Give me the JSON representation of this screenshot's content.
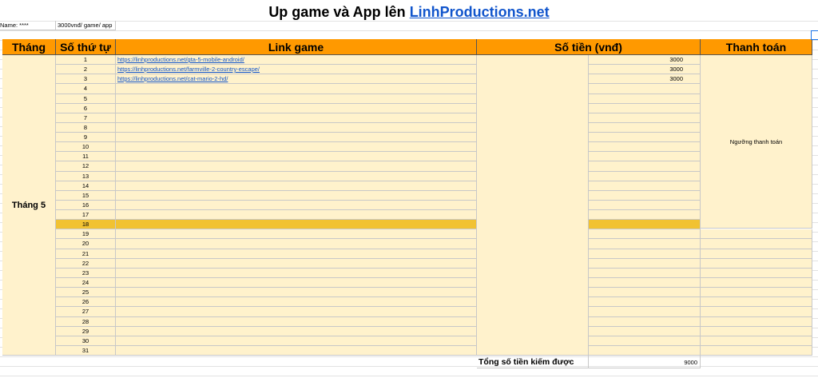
{
  "title": {
    "prefix": "Up game và App lên ",
    "link": "LinhProductions.net"
  },
  "info": {
    "name": "Name: ****",
    "rate": "3000vnđ/ game/ app"
  },
  "headers": {
    "month": "Tháng",
    "index": "Số thứ tự",
    "link": "Link game",
    "amount": "Số tiền (vnđ)",
    "payment": "Thanh toán"
  },
  "month_label": "Tháng 5",
  "threshold_label": "Ngưỡng thanh toán",
  "rows": [
    {
      "n": "1",
      "link": "https://linhproductions.net/gta-5-mobile-android/",
      "amount": "3000"
    },
    {
      "n": "2",
      "link": "https://linhproductions.net/farmville-2-country-escape/",
      "amount": "3000"
    },
    {
      "n": "3",
      "link": "https://linhproductions.net/cat-mario-2-hd/",
      "amount": "3000"
    },
    {
      "n": "4",
      "link": "",
      "amount": ""
    },
    {
      "n": "5",
      "link": "",
      "amount": ""
    },
    {
      "n": "6",
      "link": "",
      "amount": ""
    },
    {
      "n": "7",
      "link": "",
      "amount": ""
    },
    {
      "n": "8",
      "link": "",
      "amount": ""
    },
    {
      "n": "9",
      "link": "",
      "amount": ""
    },
    {
      "n": "10",
      "link": "",
      "amount": ""
    },
    {
      "n": "11",
      "link": "",
      "amount": ""
    },
    {
      "n": "12",
      "link": "",
      "amount": ""
    },
    {
      "n": "13",
      "link": "",
      "amount": ""
    },
    {
      "n": "14",
      "link": "",
      "amount": ""
    },
    {
      "n": "15",
      "link": "",
      "amount": ""
    },
    {
      "n": "16",
      "link": "",
      "amount": ""
    },
    {
      "n": "17",
      "link": "",
      "amount": ""
    },
    {
      "n": "18",
      "link": "",
      "amount": ""
    },
    {
      "n": "19",
      "link": "",
      "amount": ""
    },
    {
      "n": "20",
      "link": "",
      "amount": ""
    },
    {
      "n": "21",
      "link": "",
      "amount": ""
    },
    {
      "n": "22",
      "link": "",
      "amount": ""
    },
    {
      "n": "23",
      "link": "",
      "amount": ""
    },
    {
      "n": "24",
      "link": "",
      "amount": ""
    },
    {
      "n": "25",
      "link": "",
      "amount": ""
    },
    {
      "n": "26",
      "link": "",
      "amount": ""
    },
    {
      "n": "27",
      "link": "",
      "amount": ""
    },
    {
      "n": "28",
      "link": "",
      "amount": ""
    },
    {
      "n": "29",
      "link": "",
      "amount": ""
    },
    {
      "n": "30",
      "link": "",
      "amount": ""
    },
    {
      "n": "31",
      "link": "",
      "amount": ""
    }
  ],
  "highlight_row": "18",
  "total": {
    "label": "Tổng số tiền kiếm được",
    "value": "9000"
  }
}
